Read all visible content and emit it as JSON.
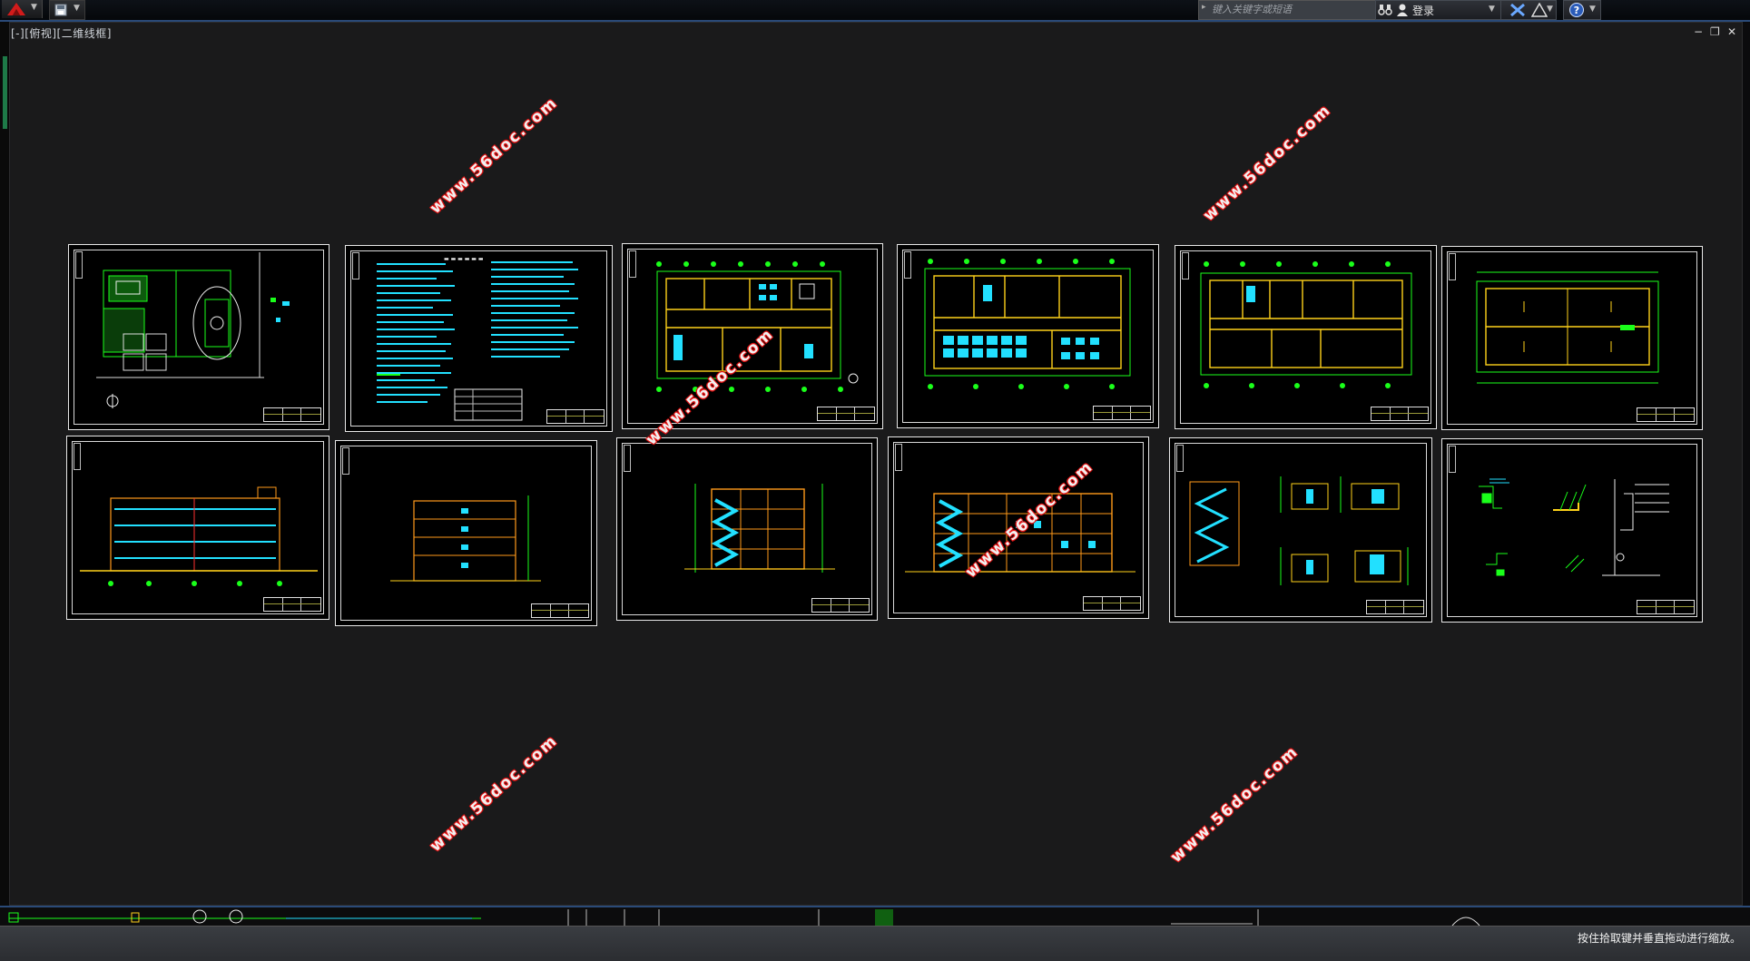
{
  "toolbar": {
    "app_button_icon": "autocad-app-icon",
    "quick_access_icon": "save-icon",
    "search_placeholder": "键入关键字或短语",
    "login_label": "登录",
    "exchange_icon": "exchange-x-icon",
    "a360_icon": "a360-icon",
    "help_icon": "help-icon"
  },
  "viewport": {
    "label": "[-][俯视][二维线框]",
    "controls": [
      "−",
      "❐",
      "✕"
    ]
  },
  "watermark_text": "www.56doc.com",
  "colors": {
    "background": "#1a1a1b",
    "green": "#1aff1a",
    "cyan": "#22e0ff",
    "yellow": "#ffd21a",
    "orange": "#ff9a1a",
    "watermark_shadow": "#d91010"
  },
  "status": {
    "message": "按住拾取键并垂直拖动进行缩放。"
  }
}
